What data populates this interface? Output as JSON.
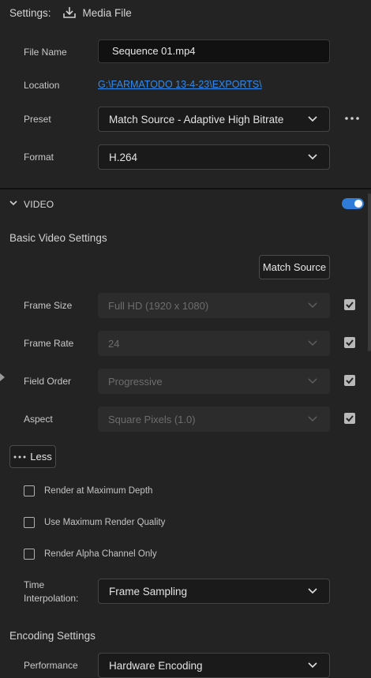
{
  "header": {
    "label": "Settings:",
    "title": "Media File"
  },
  "file_name": {
    "label": "File Name",
    "value": "Sequence 01.mp4"
  },
  "location": {
    "label": "Location",
    "value": "G:\\FARMATODO 13-4-23\\EXPORTS\\"
  },
  "preset": {
    "label": "Preset",
    "value": "Match Source - Adaptive High Bitrate"
  },
  "format": {
    "label": "Format",
    "value": "H.264"
  },
  "video": {
    "section_label": "VIDEO",
    "toggle_on": true,
    "basic_title": "Basic Video Settings",
    "match_source_label": "Match Source",
    "frame_size": {
      "label": "Frame Size",
      "value": "Full HD (1920 x 1080)",
      "checked": true
    },
    "frame_rate": {
      "label": "Frame Rate",
      "value": "24",
      "checked": true
    },
    "field_order": {
      "label": "Field Order",
      "value": "Progressive",
      "checked": true
    },
    "aspect": {
      "label": "Aspect",
      "value": "Square Pixels (1.0)",
      "checked": true
    },
    "less_label": "Less",
    "render_max_depth": {
      "label": "Render at Maximum Depth",
      "checked": false
    },
    "max_render_quality": {
      "label": "Use Maximum Render Quality",
      "checked": false
    },
    "alpha_only": {
      "label": "Render Alpha Channel Only",
      "checked": false
    },
    "time_interp": {
      "label_line1": "Time",
      "label_line2": "Interpolation:",
      "value": "Frame Sampling"
    }
  },
  "encoding": {
    "title": "Encoding Settings",
    "performance": {
      "label": "Performance",
      "value": "Hardware Encoding"
    }
  },
  "colors": {
    "accent": "#2f7bd8",
    "link": "#2e8bf0",
    "background": "#232323"
  }
}
